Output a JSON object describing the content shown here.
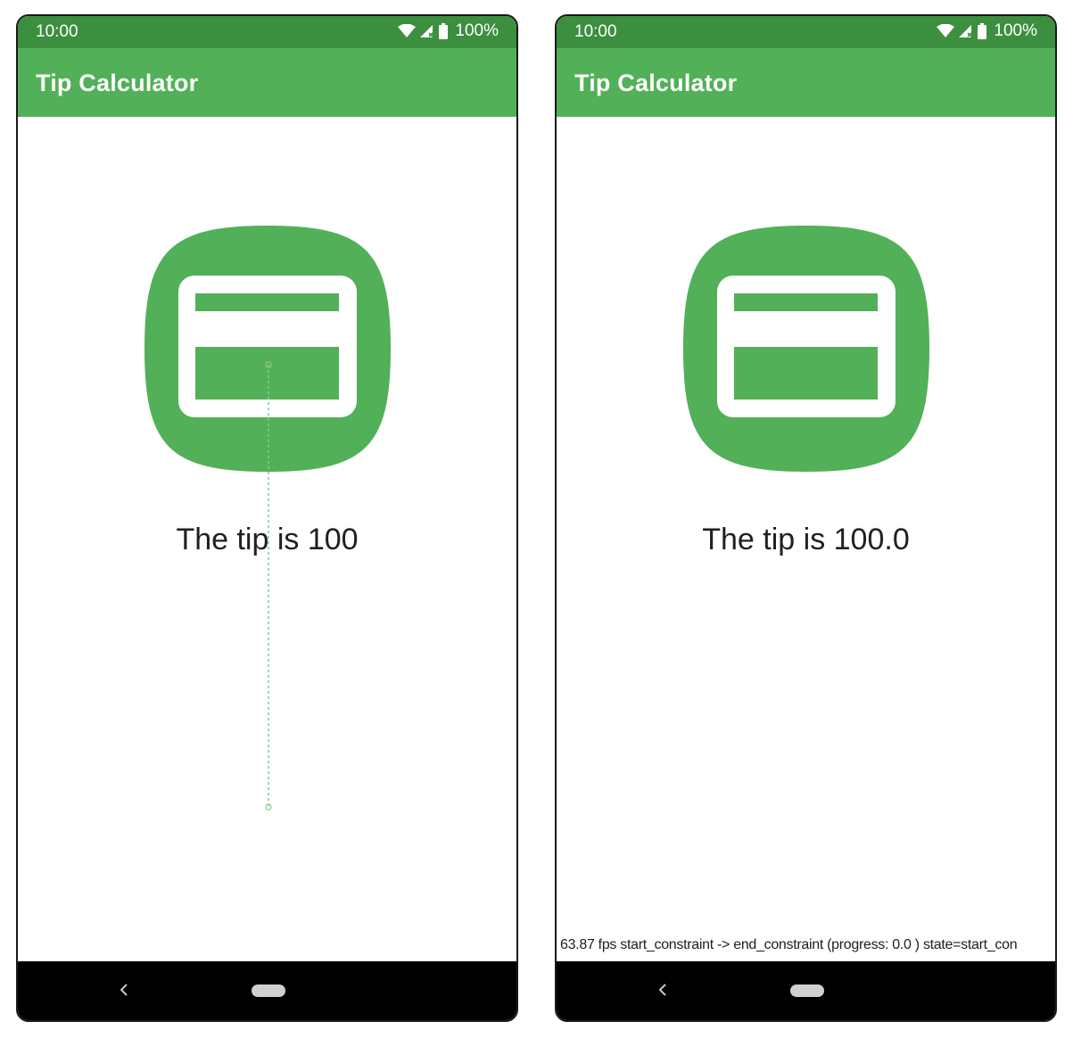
{
  "screens": [
    {
      "status": {
        "time": "10:00",
        "battery": "100%"
      },
      "app_title": "Tip Calculator",
      "tip_text": "The tip is 100"
    },
    {
      "status": {
        "time": "10:00",
        "battery": "100%"
      },
      "app_title": "Tip Calculator",
      "tip_text": "The tip is 100.0",
      "debug_text": "63.87 fps start_constraint -> end_constraint (progress: 0.0 ) state=start_con"
    }
  ],
  "icons": {
    "status": [
      "wifi-icon",
      "cell-signal-icon",
      "battery-icon"
    ],
    "app": "calculator-app-icon",
    "nav": [
      "back-icon",
      "home-pill"
    ]
  },
  "colors": {
    "status_bar": "#3b8f3f",
    "app_bar": "#52b058",
    "accent_green": "#52b058",
    "nav_bar": "#000000"
  }
}
